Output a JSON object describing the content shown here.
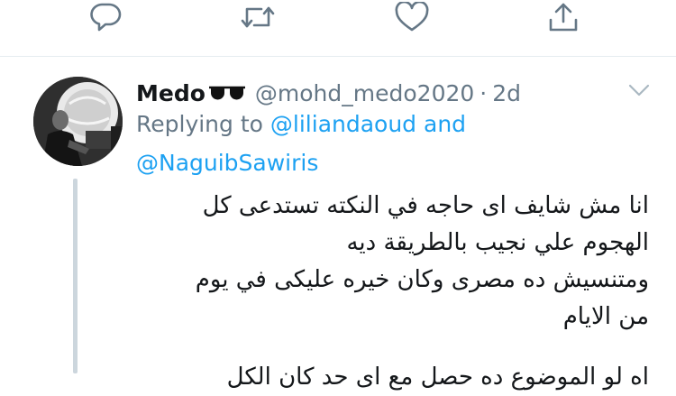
{
  "actions": [
    {
      "icon": "reply-icon"
    },
    {
      "icon": "retweet-icon"
    },
    {
      "icon": "like-icon"
    },
    {
      "icon": "share-icon"
    }
  ],
  "tweet": {
    "author_name": "Medo",
    "author_emoji": "sunglasses-icon",
    "handle": "@mohd_medo2020",
    "separator": "·",
    "time": "2d",
    "replying_prefix": "Replying to",
    "reply_to_1": "@liliandaoud",
    "reply_joiner": "and",
    "reply_to_2": "@NaguibSawiris",
    "text_lines": [
      "انا مش شايف اى حاجه في النكته تستدعى كل",
      "الهجوم علي نجيب بالطريقة ديه",
      "ومتنسيش ده مصرى وكان خيره عليكى في يوم",
      "من الايام"
    ],
    "text_cut_line": "اه لو الموضوع ده حصل مع اى حد كان الكل"
  },
  "colors": {
    "icon_gray": "#657786",
    "link_blue": "#1da1f2",
    "divider": "#e6ecf0",
    "thread_line": "#ccd6dd"
  }
}
